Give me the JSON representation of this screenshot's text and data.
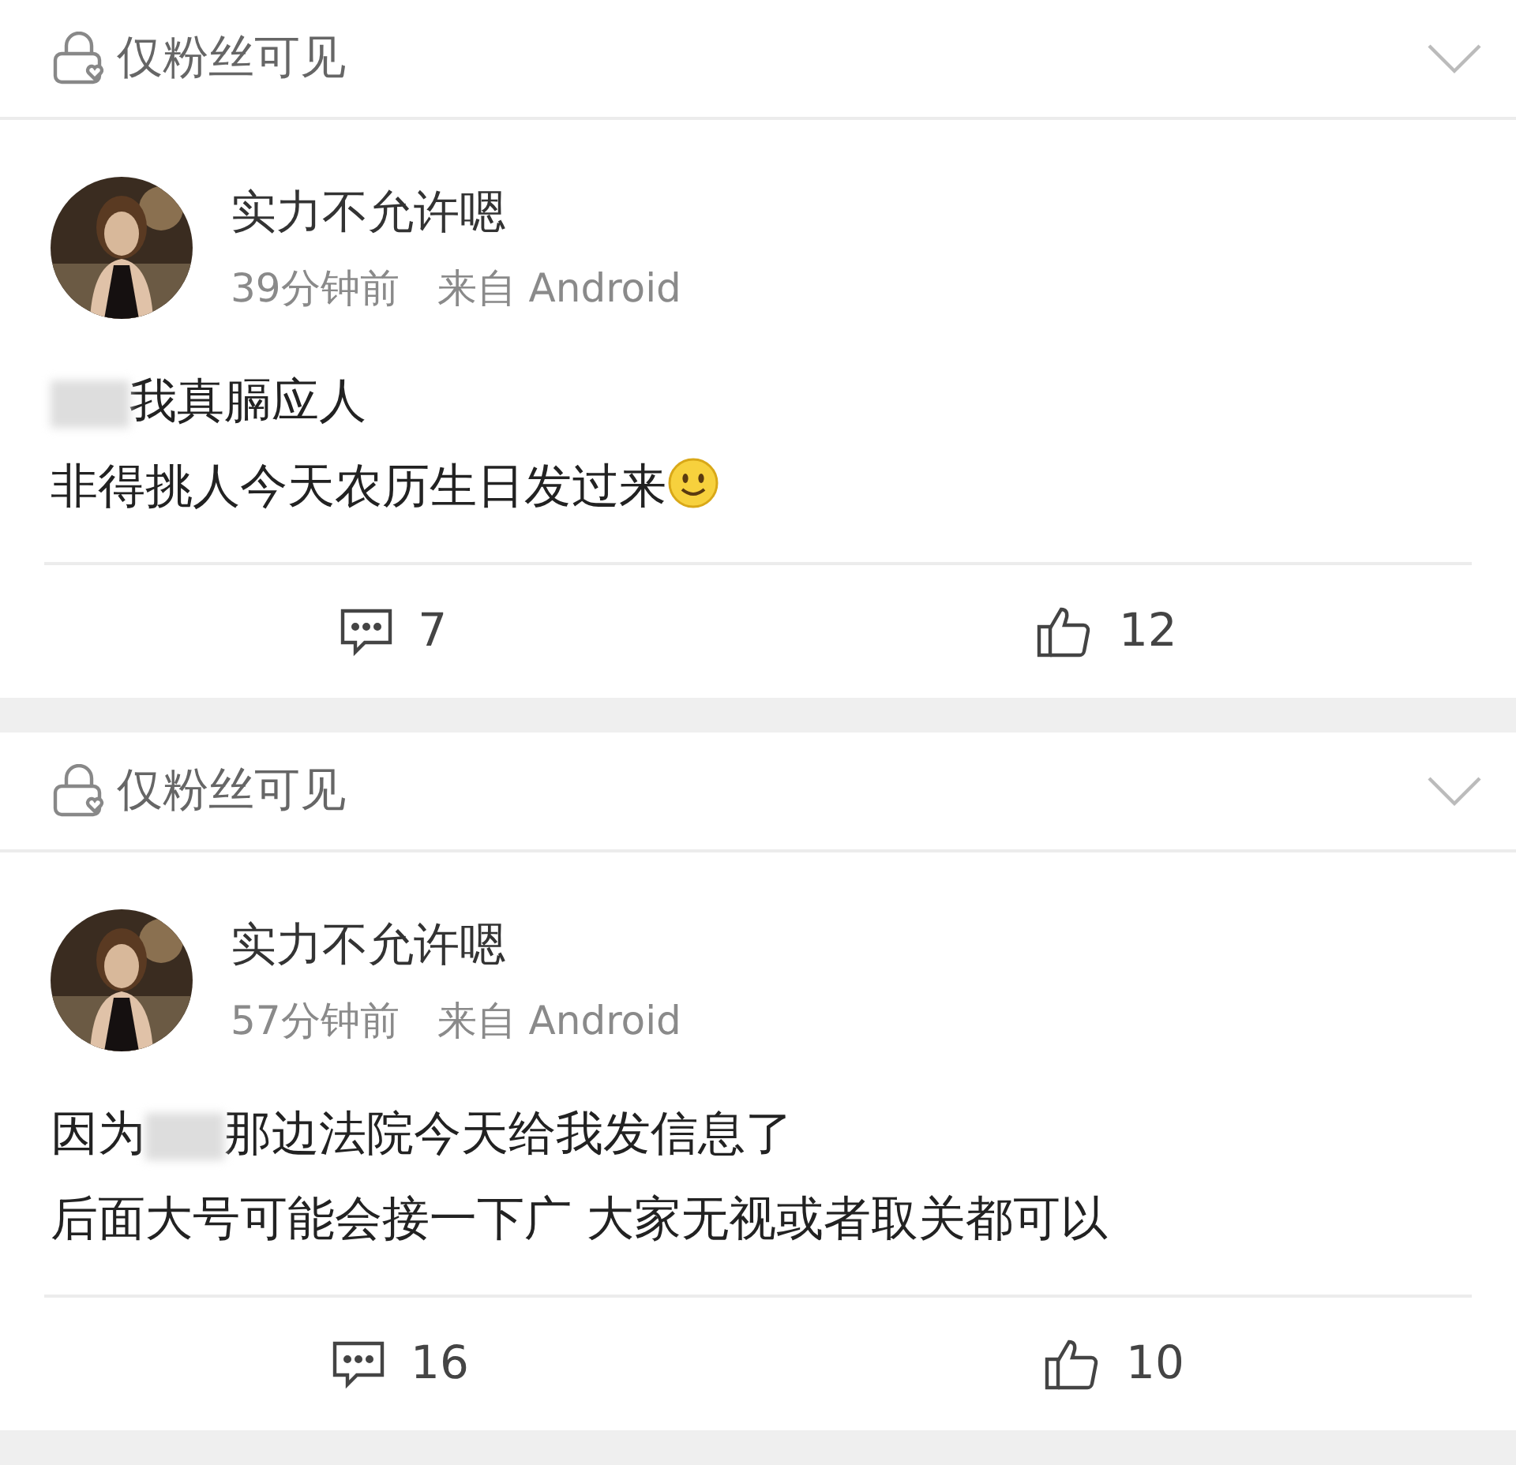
{
  "posts": [
    {
      "visibility": "仅粉丝可见",
      "user": {
        "name": "实力不允许嗯"
      },
      "time": "39分钟前",
      "source": "来自 Android",
      "lines": [
        {
          "segments": [
            {
              "kind": "redaction"
            },
            {
              "kind": "text",
              "text": "我真膈应人"
            }
          ]
        },
        {
          "segments": [
            {
              "kind": "text",
              "text": "非得挑人今天农历生日发过来"
            },
            {
              "kind": "emoji"
            }
          ]
        }
      ],
      "comments": "7",
      "likes": "12"
    },
    {
      "visibility": "仅粉丝可见",
      "user": {
        "name": "实力不允许嗯"
      },
      "time": "57分钟前",
      "source": "来自 Android",
      "lines": [
        {
          "segments": [
            {
              "kind": "text",
              "text": "因为"
            },
            {
              "kind": "redaction"
            },
            {
              "kind": "text",
              "text": "那边法院今天给我发信息了"
            }
          ]
        },
        {
          "segments": [
            {
              "kind": "text",
              "text": "后面大号可能会接一下广 大家无视或者取关都可以"
            }
          ]
        }
      ],
      "comments": "16",
      "likes": "10"
    }
  ]
}
